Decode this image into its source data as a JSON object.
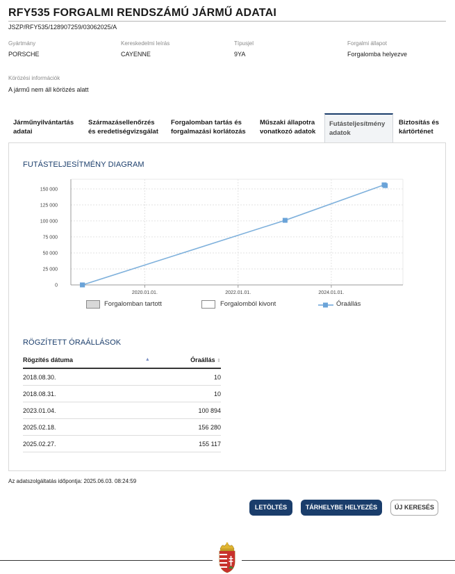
{
  "header": {
    "title": "RFY535 FORGALMI RENDSZÁMÚ JÁRMŰ ADATAI",
    "reference": "JSZP/RFY535/128907259/03062025/A"
  },
  "vehicle": {
    "manufacturer_label": "Gyártmány",
    "manufacturer": "PORSCHE",
    "commercial_label": "Kereskedelmi leírás",
    "commercial": "CAYENNE",
    "type_label": "Típusjel",
    "type": "9YA",
    "status_label": "Forgalmi állapot",
    "status": "Forgalomba helyezve",
    "wanted_label": "Körözési információk",
    "wanted": "A jármű nem áll körözés alatt"
  },
  "tabs": [
    {
      "line1": "Járműnyilvántartás",
      "line2": "adatai"
    },
    {
      "line1": "Származásellenőrzés",
      "line2": "és eredetiségvizsgálat"
    },
    {
      "line1": "Forgalomban tartás és",
      "line2": "forgalmazási korlátozás"
    },
    {
      "line1": "Műszaki állapotra",
      "line2": "vonatkozó adatok"
    },
    {
      "line1": "Futásteljesítmény",
      "line2": "adatok"
    },
    {
      "line1": "Biztosítás és",
      "line2": "kártörténet"
    }
  ],
  "diagram": {
    "section_title": "FUTÁSTELJESÍTMÉNY DIAGRAM",
    "legend": {
      "in_traffic": "Forgalomban tartott",
      "withdrawn": "Forgalomból kivont",
      "odometer": "Óraállás"
    }
  },
  "chart_data": {
    "type": "line",
    "title": "",
    "xlabel": "",
    "ylabel": "",
    "x_ticks": [
      "2020.01.01.",
      "2022.01.01.",
      "2024.01.01."
    ],
    "y_ticks": [
      "0",
      "25 000",
      "50 000",
      "75 000",
      "100 000",
      "125 000",
      "150 000"
    ],
    "ylim": [
      0,
      165000
    ],
    "grid": true,
    "series": [
      {
        "name": "Óraállás",
        "color": "#7fb1dc",
        "points": [
          {
            "x": "2018-08-30",
            "y": 10
          },
          {
            "x": "2018-08-31",
            "y": 10
          },
          {
            "x": "2023-01-04",
            "y": 100894
          },
          {
            "x": "2025-02-18",
            "y": 156280
          },
          {
            "x": "2025-02-27",
            "y": 155117
          }
        ]
      }
    ]
  },
  "records": {
    "section_title": "RÖGZÍTETT ÓRAÁLLÁSOK",
    "col_date": "Rögzítés dátuma",
    "col_value": "Óraállás",
    "rows": [
      {
        "date": "2018.08.30.",
        "value": "10"
      },
      {
        "date": "2018.08.31.",
        "value": "10"
      },
      {
        "date": "2023.01.04.",
        "value": "100 894"
      },
      {
        "date": "2025.02.18.",
        "value": "156 280"
      },
      {
        "date": "2025.02.27.",
        "value": "155 117"
      }
    ]
  },
  "footer": {
    "timestamp": "Az adatszolgáltatás időpontja: 2025.06.03. 08:24:59",
    "download": "LETÖLTÉS",
    "store": "TÁRHELYBE HELYEZÉS",
    "new_search": "ÚJ KERESÉS"
  }
}
